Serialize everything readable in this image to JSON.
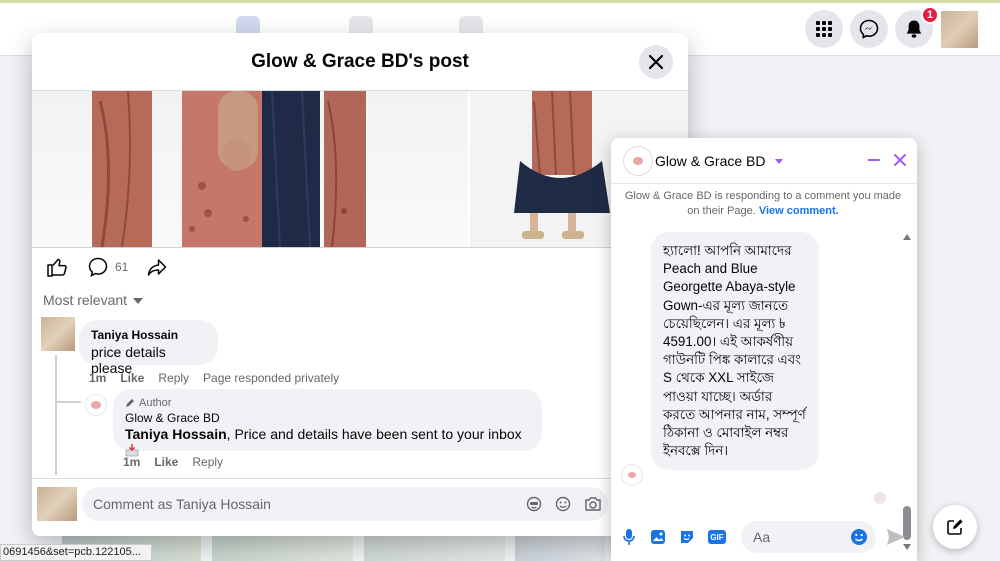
{
  "post_modal": {
    "title": "Glow & Grace BD's post",
    "comment_count": "61",
    "sort_label": "Most relevant",
    "comments": [
      {
        "name": "Taniya Hossain",
        "text": "price details please",
        "time": "1m",
        "like": "Like",
        "reply": "Reply",
        "extra": "Page responded privately"
      }
    ],
    "reply": {
      "badge": "Author",
      "name": "Glow & Grace BD",
      "mention": "Taniya Hossain",
      "text": ", Price and details have been sent to your inbox",
      "time": "1m",
      "like": "Like",
      "reply": "Reply"
    },
    "comment_placeholder": "Comment as Taniya Hossain"
  },
  "topbar": {
    "notification_count": "1"
  },
  "status_bar": {
    "url": "0691456&set=pcb.122105..."
  },
  "chat": {
    "name": "Glow & Grace BD",
    "note": "Glow & Grace BD is responding to a comment you made on their Page.",
    "note_link": "View comment.",
    "message": "হ্যালো! আপনি আমাদের Peach and Blue Georgette Abaya-style Gown-এর মূল্য জানতে চেয়েছিলেন। এর মূল্য ৳ 4591.00। এই আকর্ষণীয় গাউনটি পিঙ্ক কালারে এবং S থেকে XXL সাইজে পাওয়া যাচ্ছে। অর্ডার করতে আপনার নাম, সম্পূর্ণ ঠিকানা ও মোবাইল নম্বর ইনবক্সে দিন।",
    "input_placeholder": "Aa",
    "gif_label": "GIF"
  },
  "colors": {
    "accent": "#1b74e4",
    "messenger_purple": "#a855f7",
    "badge_red": "#e41e3f"
  }
}
